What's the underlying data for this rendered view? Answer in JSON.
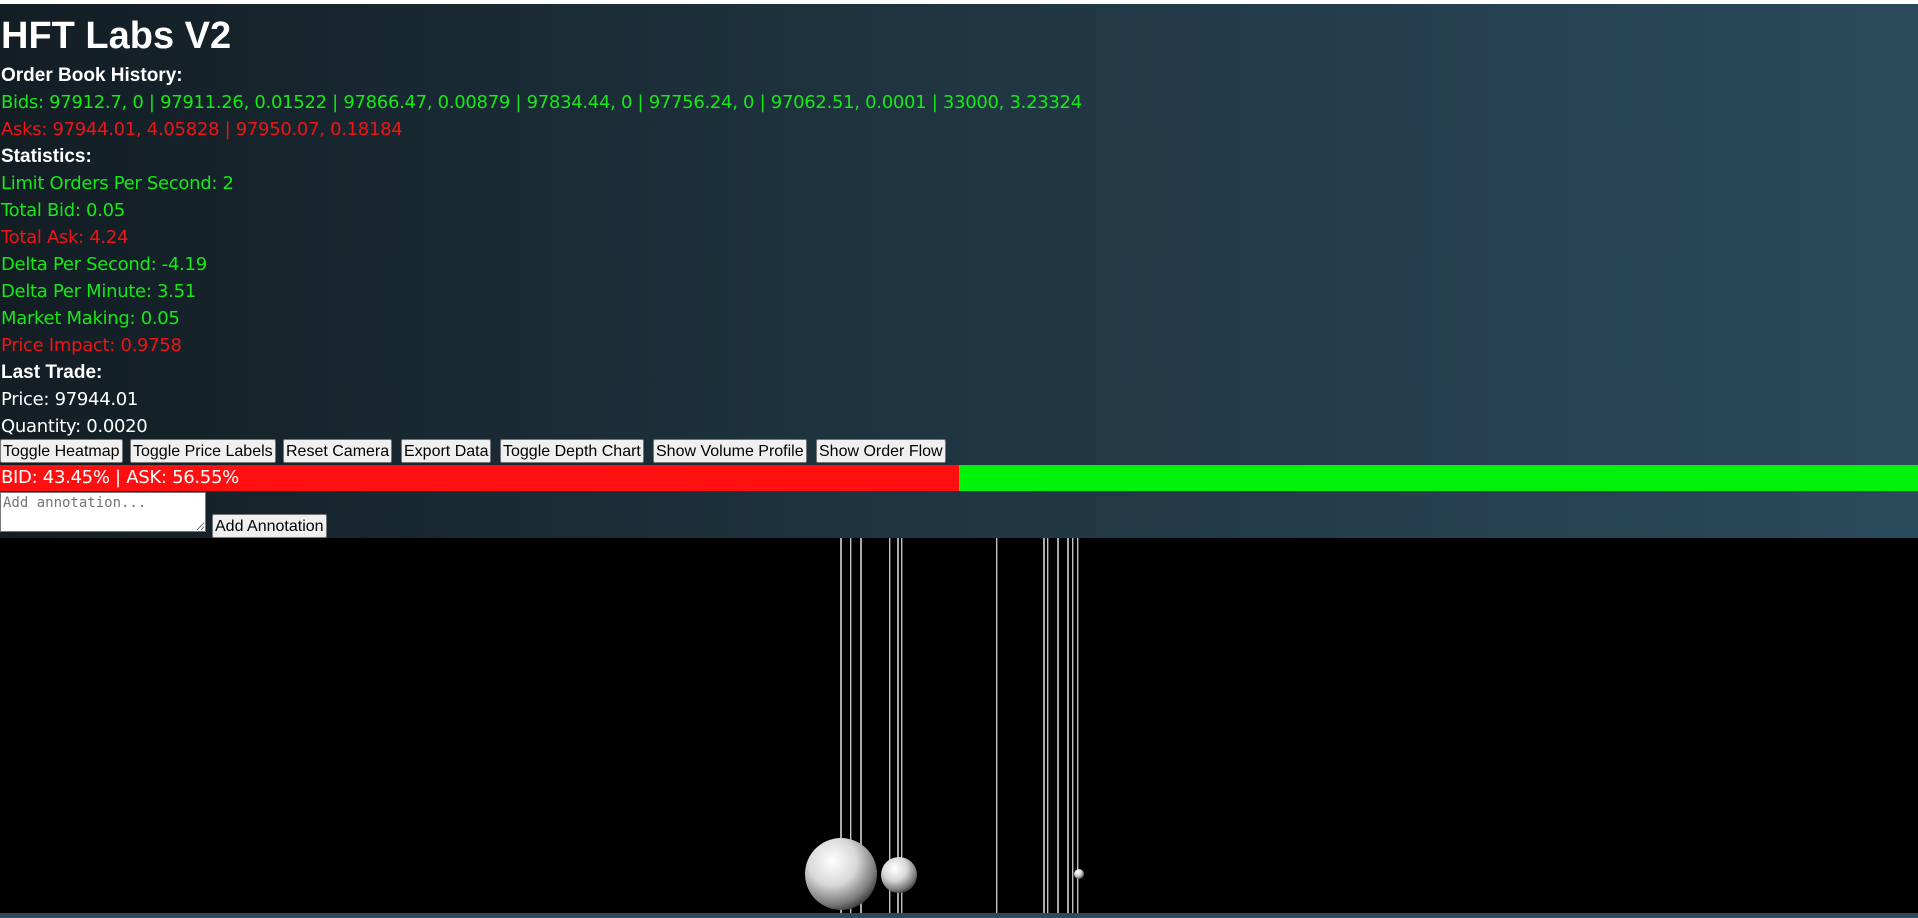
{
  "app": {
    "title": "HFT Labs V2"
  },
  "order_book": {
    "heading": "Order Book History:",
    "bids": "Bids: 97912.7, 0 | 97911.26, 0.01522 | 97866.47, 0.00879 | 97834.44, 0 | 97756.24, 0 | 97062.51, 0.0001 | 33000, 3.23324",
    "asks": "Asks: 97944.01, 4.05828 | 97950.07, 0.18184"
  },
  "statistics": {
    "heading": "Statistics:",
    "limit_orders_per_second": "Limit Orders Per Second: 2",
    "total_bid": "Total Bid: 0.05",
    "total_ask": "Total Ask: 4.24",
    "delta_per_second": "Delta Per Second: -4.19",
    "delta_per_minute": "Delta Per Minute: 3.51",
    "market_making": "Market Making: 0.05",
    "price_impact": "Price Impact: 0.9758"
  },
  "last_trade": {
    "heading": "Last Trade:",
    "price": "Price: 97944.01",
    "quantity": "Quantity: 0.0020"
  },
  "toolbar": {
    "toggle_heatmap": "Toggle Heatmap",
    "toggle_price_labels": "Toggle Price Labels",
    "reset_camera": "Reset Camera",
    "export_data": "Export Data",
    "toggle_depth_chart": "Toggle Depth Chart",
    "show_volume_profile": "Show Volume Profile",
    "show_order_flow": "Show Order Flow"
  },
  "ratio_bar": {
    "label": "BID: 43.45% | ASK: 56.55%",
    "bid_percent": 50.0,
    "bid_color": "#ff0f0f",
    "ask_color": "#00f20a"
  },
  "annotation": {
    "placeholder": "Add annotation...",
    "value": "",
    "button_label": "Add Annotation"
  },
  "colors": {
    "positive": "#17e817",
    "negative": "#ee1515",
    "scene_background": "#000000"
  }
}
